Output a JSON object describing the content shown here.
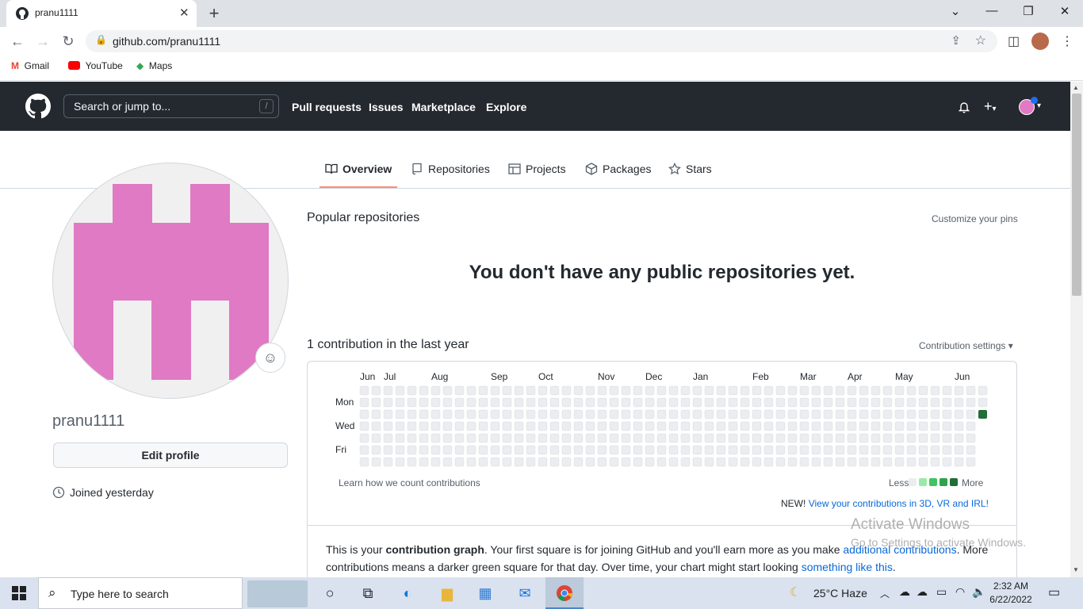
{
  "browser": {
    "tab_title": "pranu1111",
    "url": "github.com/pranu1111",
    "bookmarks": [
      "Gmail",
      "YouTube",
      "Maps"
    ]
  },
  "header": {
    "search_placeholder": "Search or jump to...",
    "search_shortcut": "/",
    "nav": [
      "Pull requests",
      "Issues",
      "Marketplace",
      "Explore"
    ]
  },
  "profile_tabs": [
    "Overview",
    "Repositories",
    "Projects",
    "Packages",
    "Stars"
  ],
  "profile": {
    "username": "pranu1111",
    "edit_button": "Edit profile",
    "joined": "Joined yesterday"
  },
  "main": {
    "popular_title": "Popular repositories",
    "customize_pins": "Customize your pins",
    "no_repos": "You don't have any public repositories yet.",
    "contrib_title": "1 contribution in the last year",
    "contrib_settings": "Contribution settings ▾",
    "months": [
      "Jun",
      "Jul",
      "Aug",
      "Sep",
      "Oct",
      "Nov",
      "Dec",
      "Jan",
      "Feb",
      "Mar",
      "Apr",
      "May",
      "Jun"
    ],
    "days": [
      "Mon",
      "Wed",
      "Fri"
    ],
    "learn_link": "Learn how we count contributions",
    "legend_less": "Less",
    "legend_more": "More",
    "new_prefix": "NEW!",
    "new_link": "View your contributions in 3D, VR and IRL!",
    "explain_1": "This is your ",
    "explain_bold": "contribution graph",
    "explain_2": ". Your first square is for joining GitHub and you'll earn more as you make ",
    "explain_link1": "additional contributions",
    "explain_3": ". More contributions means a darker green square for that day. Over time, your chart might start looking ",
    "explain_link2": "something like this",
    "explain_4": "."
  },
  "contribution_graph": {
    "weeks": 53,
    "contributions": [
      {
        "week": 52,
        "day": 2,
        "level": 4
      }
    ],
    "colors": {
      "empty": "#ebedf0",
      "l1": "#9be9a8",
      "l2": "#40c463",
      "l3": "#30a14e",
      "l4": "#216e39"
    }
  },
  "watermark": {
    "line1": "Activate Windows",
    "line2": "Go to Settings to activate Windows."
  },
  "taskbar": {
    "search_placeholder": "Type here to search",
    "weather": "25°C  Haze",
    "time": "2:32 AM",
    "date": "6/22/2022"
  }
}
